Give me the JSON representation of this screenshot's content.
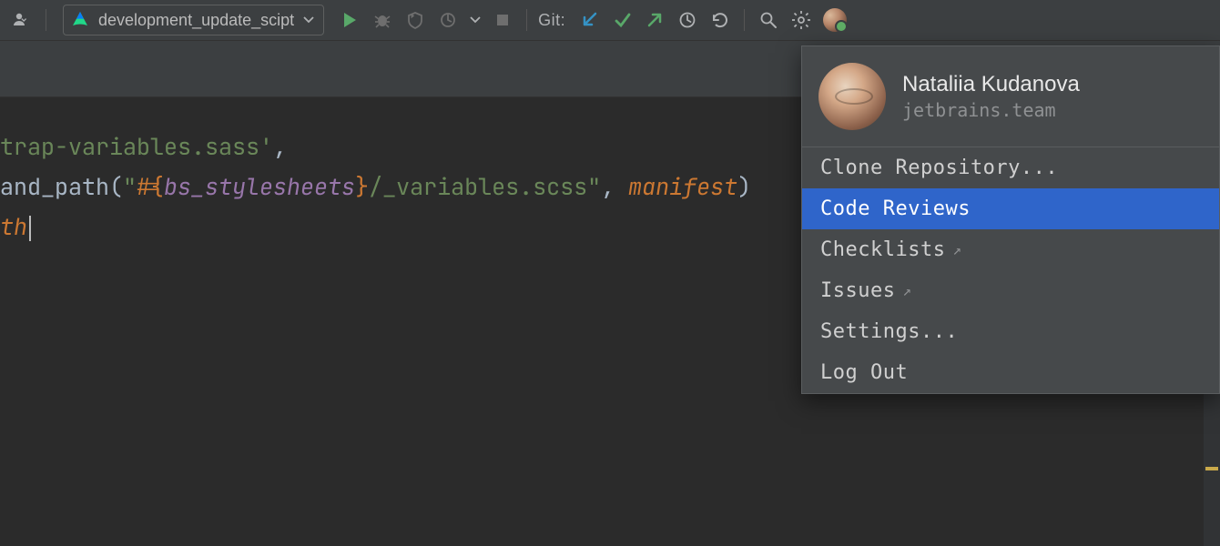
{
  "toolbar": {
    "run_config_label": "development_update_scipt",
    "git_label": "Git:"
  },
  "editor": {
    "line1_str": "trap-variables.sass'",
    "line1_comma": ",",
    "line2_fn": "and_path(",
    "line2_q1": "\"",
    "line2_interp_open": "#{",
    "line2_var": "bs_stylesheets",
    "line2_interp_close": "}",
    "line2_rest": "/_variables.scss",
    "line2_q2": "\"",
    "line2_comma": ", ",
    "line2_param": "manifest",
    "line2_paren": ")",
    "line_blank": "",
    "line_th": "th"
  },
  "popup": {
    "user_name": "Nataliia Kudanova",
    "user_org": "jetbrains.team",
    "items": [
      {
        "label": "Clone Repository...",
        "external": false,
        "highlight": false
      },
      {
        "label": "Code Reviews",
        "external": false,
        "highlight": true
      },
      {
        "label": "Checklists",
        "external": true,
        "highlight": false
      },
      {
        "label": "Issues",
        "external": true,
        "highlight": false
      },
      {
        "label": "Settings...",
        "external": false,
        "highlight": false
      },
      {
        "label": "Log Out",
        "external": false,
        "highlight": false
      }
    ]
  }
}
